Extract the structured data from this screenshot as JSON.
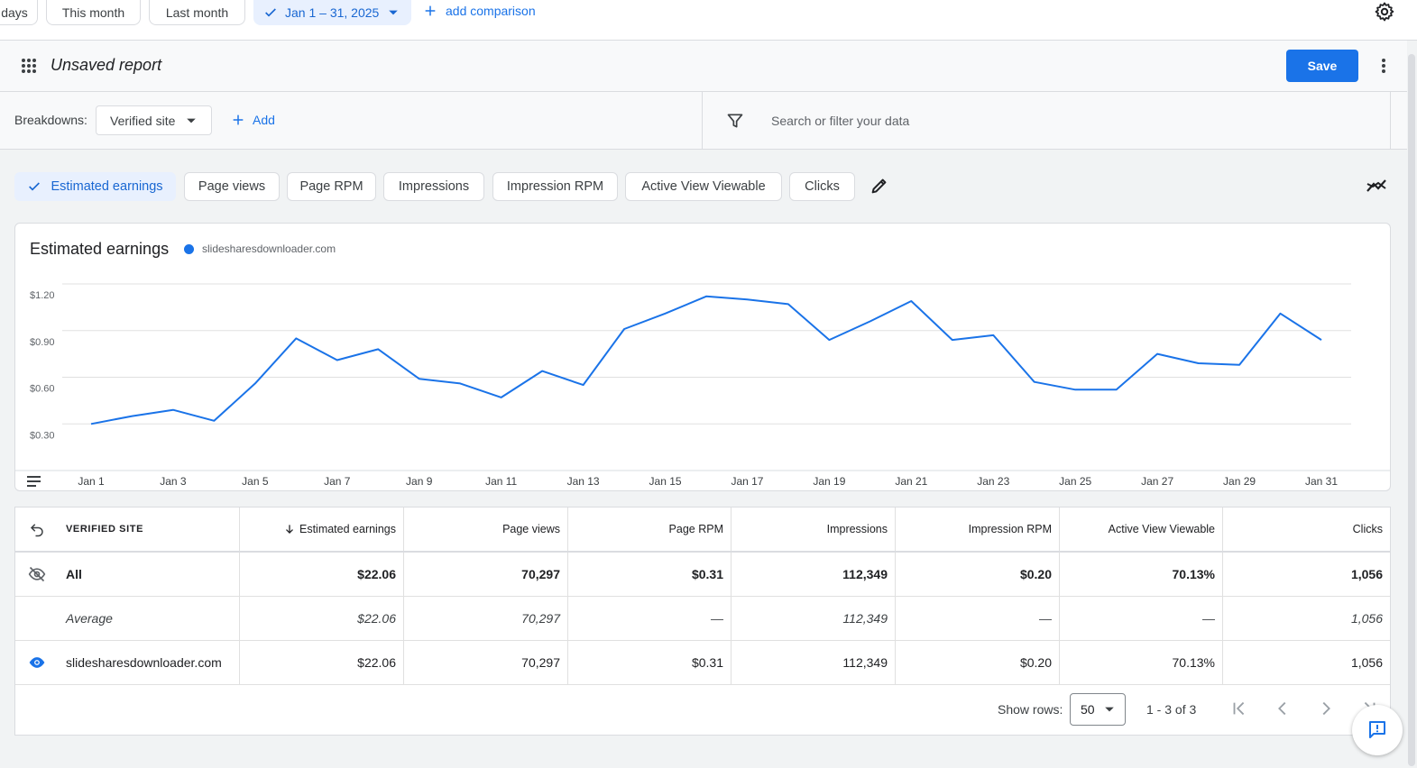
{
  "topbar": {
    "date_chips": [
      "days",
      "This month",
      "Last month"
    ],
    "selected_range": "Jan 1 – 31, 2025",
    "add_comparison": "add comparison"
  },
  "header": {
    "title": "Unsaved report",
    "save_label": "Save"
  },
  "filterbar": {
    "breakdowns_label": "Breakdowns:",
    "breakdown_value": "Verified site",
    "add_label": "Add",
    "search_placeholder": "Search or filter your data"
  },
  "metrics": [
    {
      "label": "Estimated earnings",
      "selected": true
    },
    {
      "label": "Page views",
      "selected": false
    },
    {
      "label": "Page RPM",
      "selected": false
    },
    {
      "label": "Impressions",
      "selected": false
    },
    {
      "label": "Impression RPM",
      "selected": false
    },
    {
      "label": "Active View Viewable",
      "selected": false
    },
    {
      "label": "Clicks",
      "selected": false
    }
  ],
  "chart_data": {
    "type": "line",
    "title": "Estimated earnings",
    "series": [
      {
        "name": "slidesharesdownloader.com",
        "color": "#1a73e8",
        "values": [
          0.3,
          0.35,
          0.39,
          0.32,
          0.56,
          0.85,
          0.71,
          0.78,
          0.59,
          0.56,
          0.47,
          0.64,
          0.55,
          0.91,
          1.01,
          1.12,
          1.1,
          1.07,
          0.84,
          0.96,
          1.09,
          0.84,
          0.87,
          0.57,
          0.52,
          0.52,
          0.75,
          0.69,
          0.68,
          1.01,
          0.84
        ]
      }
    ],
    "x": [
      "Jan 1",
      "Jan 2",
      "Jan 3",
      "Jan 4",
      "Jan 5",
      "Jan 6",
      "Jan 7",
      "Jan 8",
      "Jan 9",
      "Jan 10",
      "Jan 11",
      "Jan 12",
      "Jan 13",
      "Jan 14",
      "Jan 15",
      "Jan 16",
      "Jan 17",
      "Jan 18",
      "Jan 19",
      "Jan 20",
      "Jan 21",
      "Jan 22",
      "Jan 23",
      "Jan 24",
      "Jan 25",
      "Jan 26",
      "Jan 27",
      "Jan 28",
      "Jan 29",
      "Jan 30",
      "Jan 31"
    ],
    "x_tick_labels": [
      "Jan 1",
      "Jan 3",
      "Jan 5",
      "Jan 7",
      "Jan 9",
      "Jan 11",
      "Jan 13",
      "Jan 15",
      "Jan 17",
      "Jan 19",
      "Jan 21",
      "Jan 23",
      "Jan 25",
      "Jan 27",
      "Jan 29",
      "Jan 31"
    ],
    "y_tick_labels": [
      "$1.20",
      "$0.90",
      "$0.60",
      "$0.30"
    ],
    "y_ticks": [
      1.2,
      0.9,
      0.6,
      0.3
    ],
    "ylim": [
      0.0,
      1.2
    ],
    "grid": true
  },
  "table": {
    "columns": [
      "VERIFIED SITE",
      "Estimated earnings",
      "Page views",
      "Page RPM",
      "Impressions",
      "Impression RPM",
      "Active View Viewable",
      "Clicks"
    ],
    "rows": [
      {
        "label": "All",
        "values": [
          "$22.06",
          "70,297",
          "$0.31",
          "112,349",
          "$0.20",
          "70.13%",
          "1,056"
        ]
      },
      {
        "label": "Average",
        "values": [
          "$22.06",
          "70,297",
          "—",
          "112,349",
          "—",
          "—",
          "1,056"
        ]
      },
      {
        "label": "slidesharesdownloader.com",
        "values": [
          "$22.06",
          "70,297",
          "$0.31",
          "112,349",
          "$0.20",
          "70.13%",
          "1,056"
        ]
      }
    ],
    "show_rows_label": "Show rows:",
    "rows_per_page": "50",
    "range_label": "1 - 3 of 3"
  }
}
